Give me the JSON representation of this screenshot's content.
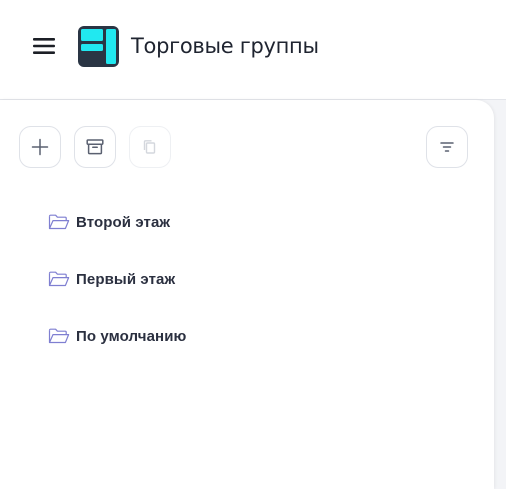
{
  "header": {
    "title": "Торговые группы",
    "menu_icon": "hamburger-menu-icon",
    "logo_icon": "app-logo-icon",
    "logo_colors": {
      "dark": "#2a3544",
      "accent": "#21e8f0"
    }
  },
  "toolbar": {
    "buttons": [
      {
        "name": "add",
        "icon": "plus-icon",
        "enabled": true
      },
      {
        "name": "archive",
        "icon": "archive-box-icon",
        "enabled": true
      },
      {
        "name": "copy",
        "icon": "copy-icon",
        "enabled": false
      },
      {
        "name": "filter",
        "icon": "filter-icon",
        "enabled": true
      }
    ]
  },
  "tree": {
    "items": [
      {
        "label": "Второй этаж",
        "icon": "folder-icon"
      },
      {
        "label": "Первый этаж",
        "icon": "folder-icon"
      },
      {
        "label": "По умолчанию",
        "icon": "folder-icon"
      }
    ]
  },
  "colors": {
    "folder_stroke": "#7f7fd1",
    "icon_gray": "#5a6070",
    "icon_disabled": "#d4d7dd",
    "text": "#2b3040"
  }
}
